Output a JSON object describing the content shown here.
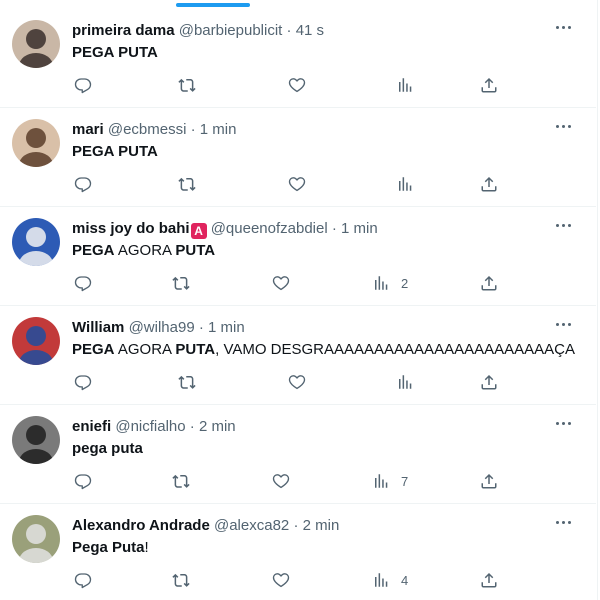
{
  "tweets": [
    {
      "name": "primeira dama",
      "handle": "@barbiepublicit",
      "time": "41 s",
      "parts": [
        {
          "t": "PEGA PUTA",
          "bold": true
        }
      ],
      "views": "",
      "avatar_colors": [
        "#c9b7a6",
        "#3a2f2b"
      ]
    },
    {
      "name": "mari",
      "handle": "@ecbmessi",
      "time": "1 min",
      "parts": [
        {
          "t": "PEGA PUTA",
          "bold": true
        }
      ],
      "views": "",
      "avatar_colors": [
        "#d9c0a8",
        "#5b3d2a"
      ]
    },
    {
      "name": "miss joy do bahi",
      "badge": "A",
      "handle": "@queenofzabdiel",
      "time": "1 min",
      "parts": [
        {
          "t": "PEGA",
          "bold": true
        },
        {
          "t": " AGORA ",
          "bold": false
        },
        {
          "t": "PUTA",
          "bold": true
        }
      ],
      "views": "2",
      "avatar_colors": [
        "#2d5bb5",
        "#f2f2f2"
      ]
    },
    {
      "name": "William",
      "handle": "@wilha99",
      "time": "1 min",
      "parts": [
        {
          "t": "PEGA",
          "bold": true
        },
        {
          "t": " AGORA ",
          "bold": false
        },
        {
          "t": "PUTA",
          "bold": true
        },
        {
          "t": ", VAMO DESGRAAAAAAAAAAAAAAAAAAAAAAAÇA",
          "bold": false
        }
      ],
      "views": "",
      "avatar_colors": [
        "#c23a3a",
        "#1f4ea0"
      ]
    },
    {
      "name": "eniefi",
      "handle": "@nicfialho",
      "time": "2 min",
      "parts": [
        {
          "t": "pega puta",
          "bold": true
        }
      ],
      "views": "7",
      "avatar_colors": [
        "#7a7a7a",
        "#1e1e1e"
      ]
    },
    {
      "name": "Alexandro Andrade",
      "handle": "@alexca82",
      "time": "2 min",
      "parts": [
        {
          "t": "Pega Puta",
          "bold": true
        },
        {
          "t": "!",
          "bold": false
        }
      ],
      "views": "4",
      "avatar_colors": [
        "#9aa07a",
        "#e2e2e2"
      ]
    }
  ],
  "meta_separator": "·",
  "icons": {
    "reply": "reply-icon",
    "retweet": "retweet-icon",
    "like": "heart-icon",
    "views": "views-icon",
    "share": "share-icon",
    "more": "more-icon"
  },
  "colors": {
    "accent": "#1d9bf0",
    "text": "#0f1419",
    "muted": "#536471",
    "border": "#eff3f4"
  }
}
